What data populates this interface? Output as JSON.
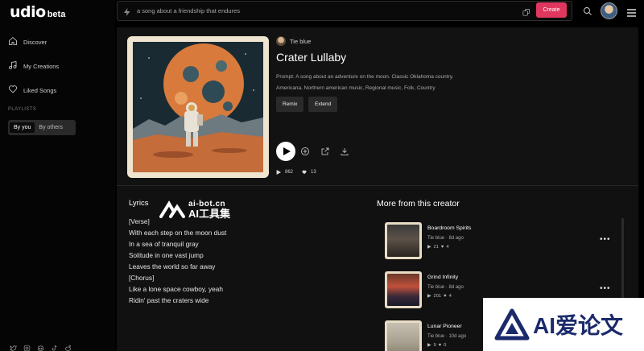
{
  "sidebar": {
    "logo": "udio",
    "logo_badge": "beta",
    "nav": [
      {
        "label": "Discover",
        "icon": "home-icon"
      },
      {
        "label": "My Creations",
        "icon": "music-note-icon"
      },
      {
        "label": "Liked Songs",
        "icon": "heart-icon"
      }
    ],
    "section_label": "PLAYLISTS",
    "toggle": {
      "active": "By you",
      "inactive": "By others"
    },
    "socials": [
      "twitter-icon",
      "instagram-icon",
      "discord-icon",
      "tiktok-icon",
      "reddit-icon"
    ]
  },
  "topbar": {
    "search_text": "a song about a friendship that endures",
    "create_label": "Create"
  },
  "song": {
    "creator": "Tie blue",
    "title": "Crater Lullaby",
    "prompt": "Prompt: A song about an adventure on the moon. Classic Oklahoma country.",
    "tags": "Americana, Northern american music, Regional music, Folk, Country",
    "remix_label": "Remix",
    "extend_label": "Extend",
    "plays": "862",
    "likes": "13"
  },
  "lyrics": {
    "title": "Lyrics",
    "lines": [
      "[Verse]",
      "With each step on the moon dust",
      "In a sea of tranquil gray",
      "Solitude in one vast jump",
      "Leaves the world so far away",
      "[Chorus]",
      "Like a lone space cowboy, yeah",
      "Ridin' past the craters wide"
    ]
  },
  "more": {
    "title": "More from this creator",
    "items": [
      {
        "title": "Boardroom Spirits",
        "creator": "Tie blue",
        "age": "8d ago",
        "plays": "21",
        "likes": "4"
      },
      {
        "title": "Grind Infinity",
        "creator": "Tie blue",
        "age": "8d ago",
        "plays": "201",
        "likes": "4"
      },
      {
        "title": "Lunar Pioneer",
        "creator": "Tie blue",
        "age": "10d ago",
        "plays": "9",
        "likes": "0"
      }
    ]
  },
  "watermarks": {
    "top_site": "ai-bot.cn",
    "top_cn": "AI工具集",
    "bottom": "AI爱论文"
  },
  "colors": {
    "accent": "#e0375f",
    "background": "#000000",
    "panel": "#111111"
  }
}
